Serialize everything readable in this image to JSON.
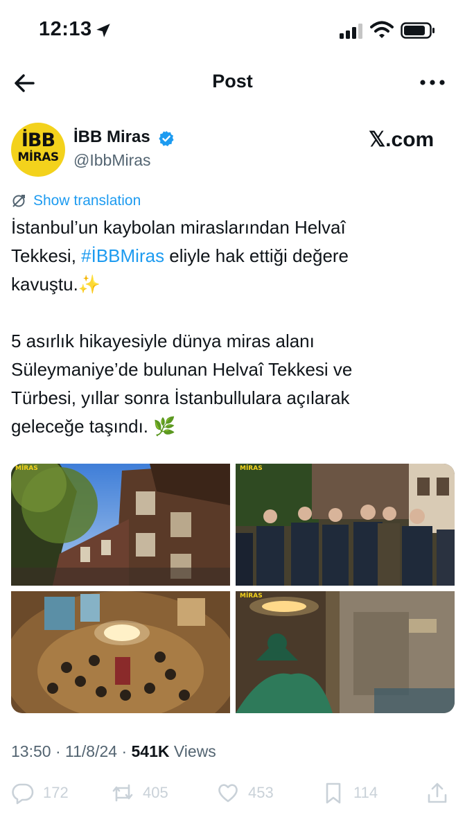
{
  "status_bar": {
    "time": "12:13"
  },
  "nav": {
    "title": "Post"
  },
  "author": {
    "avatar_line1": "İBB",
    "avatar_line2": "MİRAS",
    "name": "İBB Miras",
    "handle": "@IbbMiras",
    "source": "𝕏.com"
  },
  "translation": {
    "label": "Show translation"
  },
  "post": {
    "line1": "İstanbul’un kaybolan miraslarından Helvaî",
    "line2_prefix": "Tekkesi, ",
    "hashtag": "#İBBMiras",
    "line2_suffix": " eliyle hak ettiği değere",
    "line3": "kavuştu.✨",
    "line4": "5 asırlık hikayesiyle dünya miras alanı",
    "line5": "Süleymaniye’de bulunan Helvaî Tekkesi ve",
    "line6": "Türbesi, yıllar sonra İstanbullulara açılarak",
    "line7": "geleceğe taşındı. 🌿"
  },
  "images": {
    "watermark": "MİRAS"
  },
  "meta": {
    "time": "13:50",
    "separator": "·",
    "date": "11/8/24",
    "views_count": "541K",
    "views_label": "Views"
  },
  "actions": {
    "replies": "172",
    "reposts": "405",
    "likes": "453",
    "bookmarks": "114"
  },
  "colors": {
    "accent": "#1d9bf0",
    "avatar_bg": "#f3d21c",
    "muted": "#536471"
  }
}
